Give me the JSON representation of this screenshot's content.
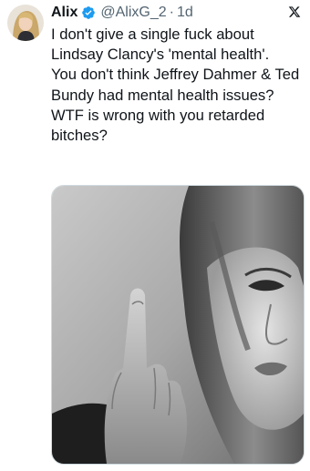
{
  "tweet": {
    "author_name": "Alix",
    "handle": "@AlixG_2",
    "separator": "·",
    "timestamp": "1d",
    "lines": [
      "I don't give a single fuck about Lindsay Clancy's 'mental health'.",
      "You don't think Jeffrey Dahmer & Ted Bundy had mental health issues?",
      "WTF is wrong with you retarded bitches?"
    ]
  },
  "icons": {
    "verified": "verified-badge-icon",
    "platform": "x-logo-icon"
  },
  "colors": {
    "verified_blue": "#1d9bf0",
    "secondary_text": "#536471",
    "primary_text": "#0f1419"
  }
}
